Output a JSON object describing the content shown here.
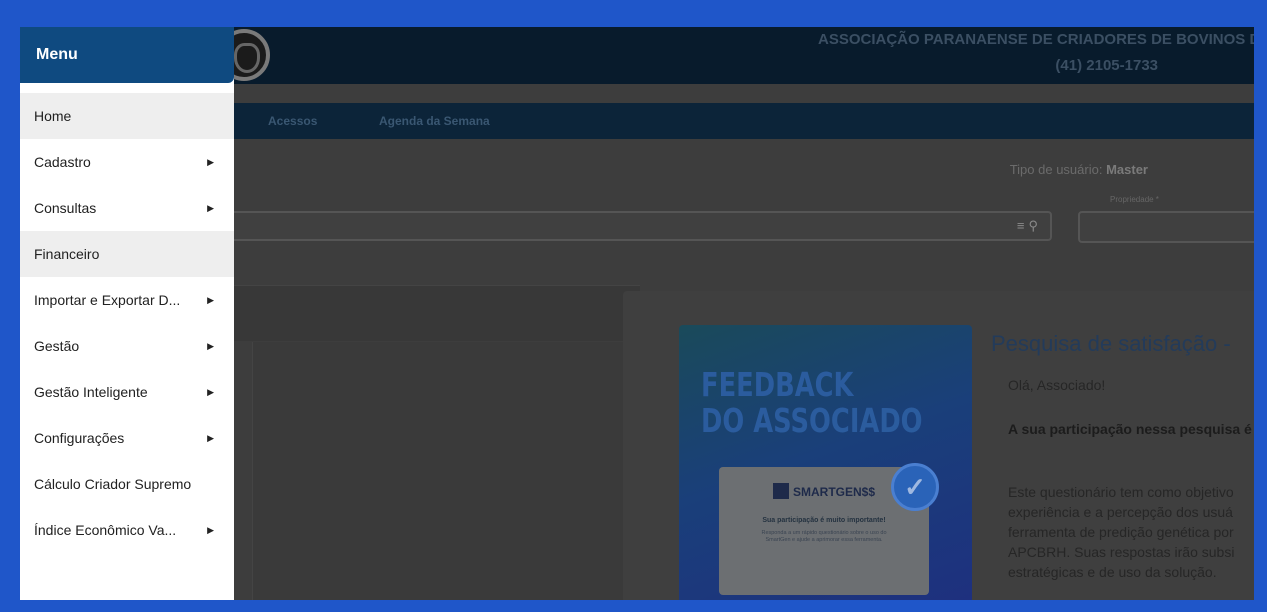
{
  "app": {
    "org_name": "ASSOCIAÇÃO PARANAENSE DE CRIADORES DE BOVINOS DA",
    "phone": "(41) 2105-1733"
  },
  "nav": {
    "items": [
      {
        "label": "Acessos"
      },
      {
        "label": "Agenda da Semana"
      }
    ]
  },
  "user": {
    "type_label": "Tipo de usuário:",
    "type_value": "Master"
  },
  "search": {
    "icons": [
      "list-icon",
      "search-icon"
    ]
  },
  "property": {
    "label": "Propriedade *"
  },
  "modal": {
    "title": "Pesquisa de satisfação -",
    "greeting": "Olá, Associado!",
    "bold_text": "A sua participação nessa pesquisa é nós.",
    "body_text": "Este questionário tem como objetivo experiência e a percepção dos usuá ferramenta de predição genética por APCBRH. Suas respostas irão subsi estratégicas e de uso da solução.",
    "banner": {
      "title": "FEEDBACK\nDO ASSOCIADO",
      "brand": "SMARTGEN",
      "brand_suffix": "$$",
      "headline": "Sua participação é muito importante!",
      "small_text": "Responda a um rápido questionário sobre o uso do SmartGen e ajude a aprimorar essa ferramenta."
    }
  },
  "menu": {
    "title": "Menu",
    "items": [
      {
        "label": "Home",
        "submenu": false,
        "highlighted": true
      },
      {
        "label": "Cadastro",
        "submenu": true,
        "highlighted": false
      },
      {
        "label": "Consultas",
        "submenu": true,
        "highlighted": false
      },
      {
        "label": "Financeiro",
        "submenu": false,
        "highlighted": true
      },
      {
        "label": "Importar e Exportar D...",
        "submenu": true,
        "highlighted": false
      },
      {
        "label": "Gestão",
        "submenu": true,
        "highlighted": false
      },
      {
        "label": "Gestão Inteligente",
        "submenu": true,
        "highlighted": false
      },
      {
        "label": "Configurações",
        "submenu": true,
        "highlighted": false
      },
      {
        "label": "Cálculo Criador Supremo",
        "submenu": false,
        "highlighted": false
      },
      {
        "label": "Índice Econômico Va...",
        "submenu": true,
        "highlighted": false
      }
    ]
  },
  "colors": {
    "frame": "#1f56c9",
    "menu_header": "#0f4a80",
    "overlay": "#3d3d3d"
  }
}
